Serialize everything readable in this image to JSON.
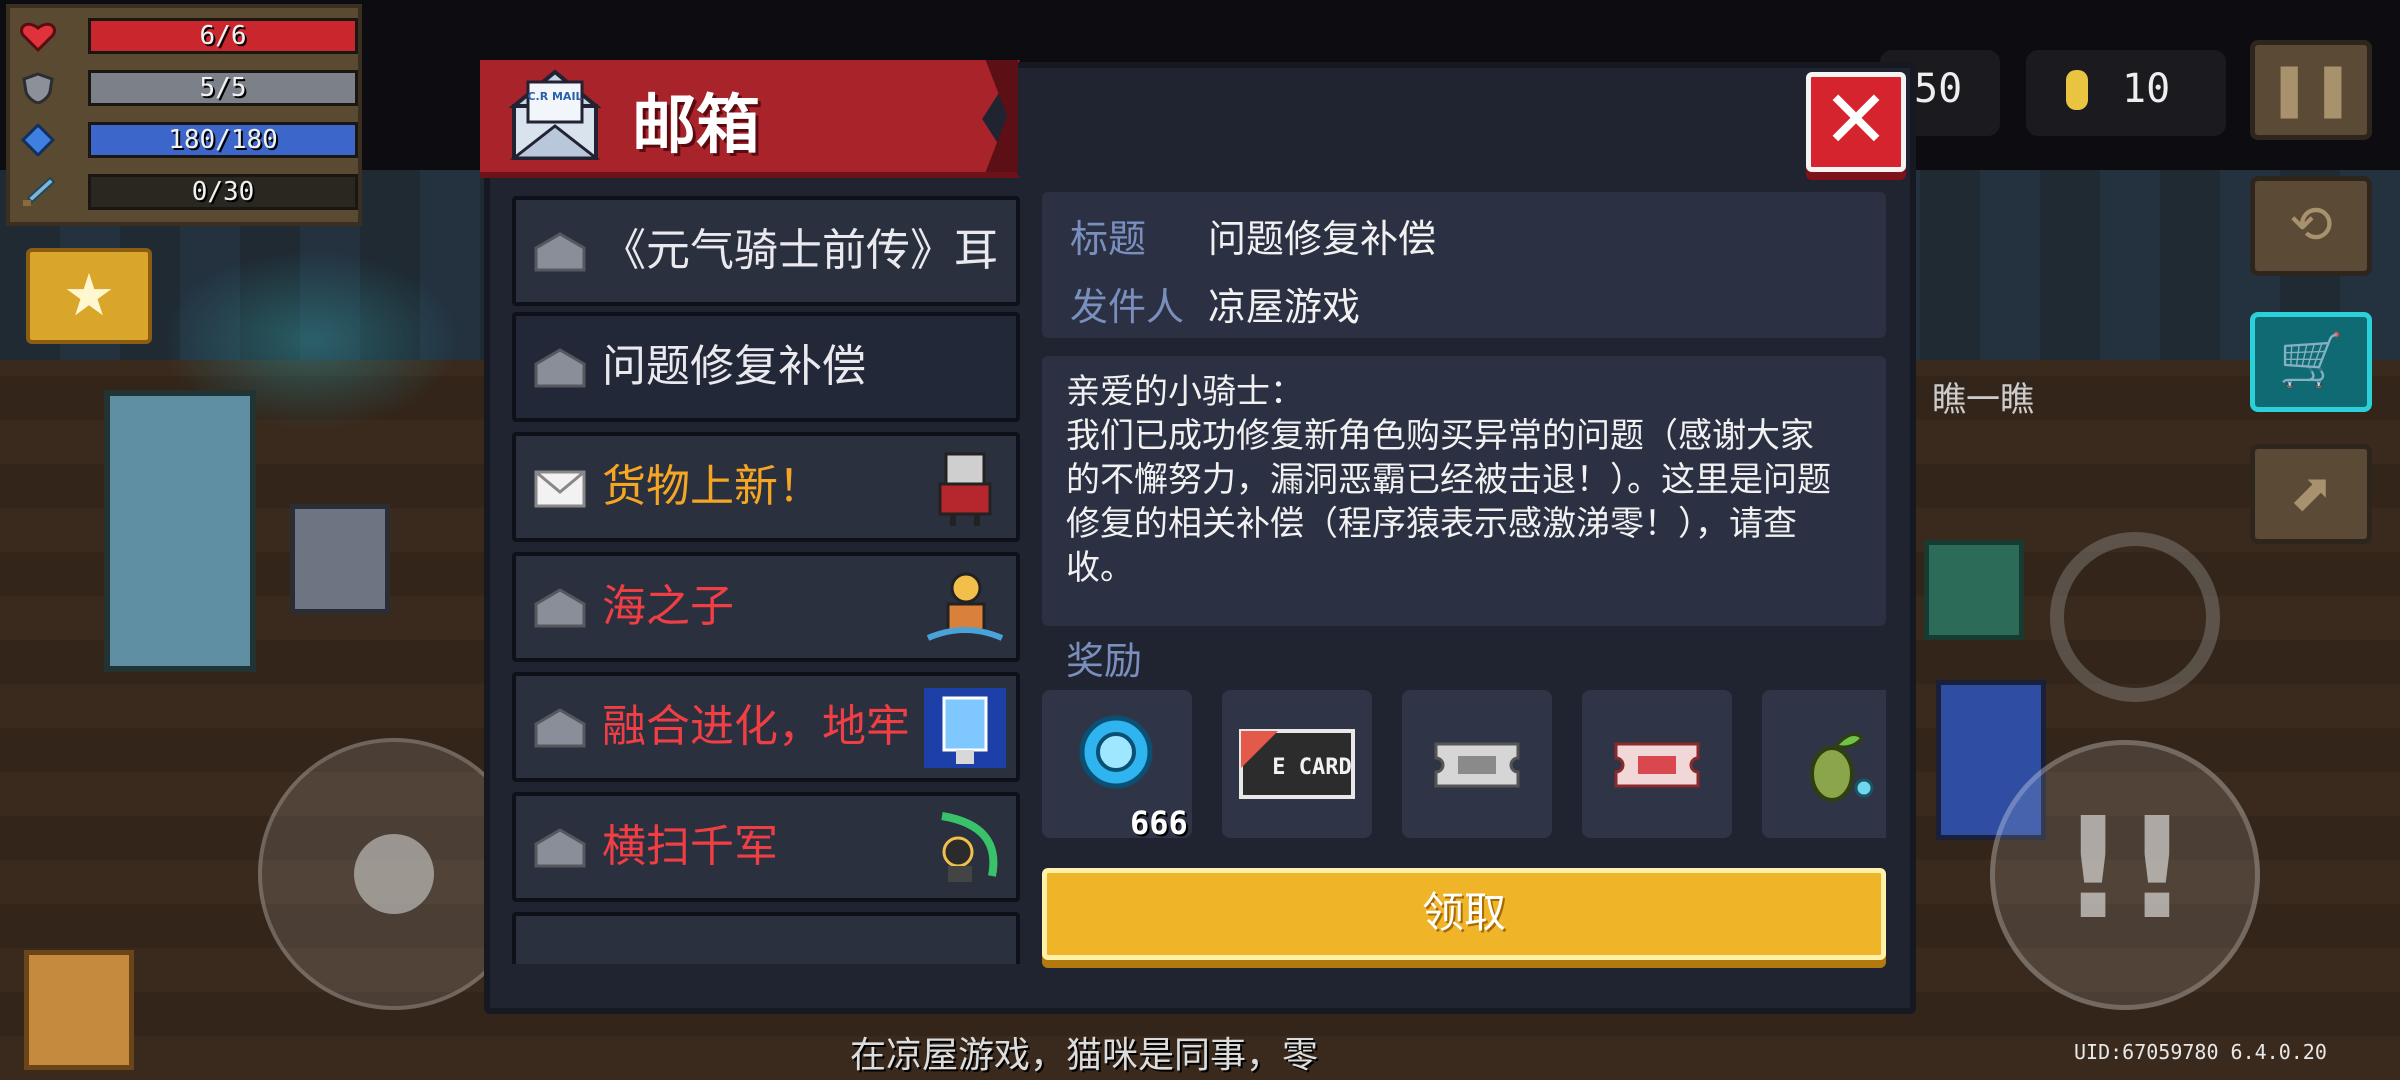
{
  "hud": {
    "health": "6/6",
    "armor": "5/5",
    "energy": "180/180",
    "skill": "0/30",
    "gems": "50",
    "coins": "10",
    "health_level": 1.0,
    "armor_level": 1.0,
    "energy_level": 1.0,
    "skill_level": 0.0
  },
  "mailbox": {
    "title": "邮箱",
    "icon_text": "C.R MAIL",
    "mails": [
      {
        "label": "《元气骑士前传》耳",
        "color": "white",
        "read": true
      },
      {
        "label": "问题修复补偿",
        "color": "white",
        "read": true,
        "selected": true
      },
      {
        "label": "货物上新！",
        "color": "orange",
        "read": false
      },
      {
        "label": "海之子",
        "color": "red",
        "read": true
      },
      {
        "label": "融合进化，地牢",
        "color": "red",
        "read": true
      },
      {
        "label": "横扫千军",
        "color": "red",
        "read": true
      }
    ],
    "detail": {
      "title_key": "标题",
      "title_value": "问题修复补偿",
      "sender_key": "发件人",
      "sender_value": "凉屋游戏",
      "body": "亲爱的小骑士：\n我们已成功修复新角色购买异常的问题（感谢大家的不懈努力，漏洞恶霸已经被击退！）。这里是问题修复的相关补偿（程序猿表示感激涕零！），请查收。",
      "reward_label": "奖励",
      "rewards": [
        {
          "icon": "gem-coin-icon",
          "qty": "666"
        },
        {
          "icon": "card-icon",
          "card_text": "E CARD"
        },
        {
          "icon": "ticket-gray-icon"
        },
        {
          "icon": "ticket-red-icon"
        },
        {
          "icon": "seed-plant-icon"
        }
      ],
      "claim_label": "领取"
    }
  },
  "background": {
    "subtitle": "在凉屋游戏，猫咪是同事，零",
    "sign": "瞧一瞧",
    "uid": "UID:67059780 6.4.0.20"
  },
  "colors": {
    "ribbon": "#a8232a",
    "claim": "#f0b428",
    "close": "#d6242e",
    "label_orange": "#f5a623",
    "label_red": "#ef3e44"
  }
}
